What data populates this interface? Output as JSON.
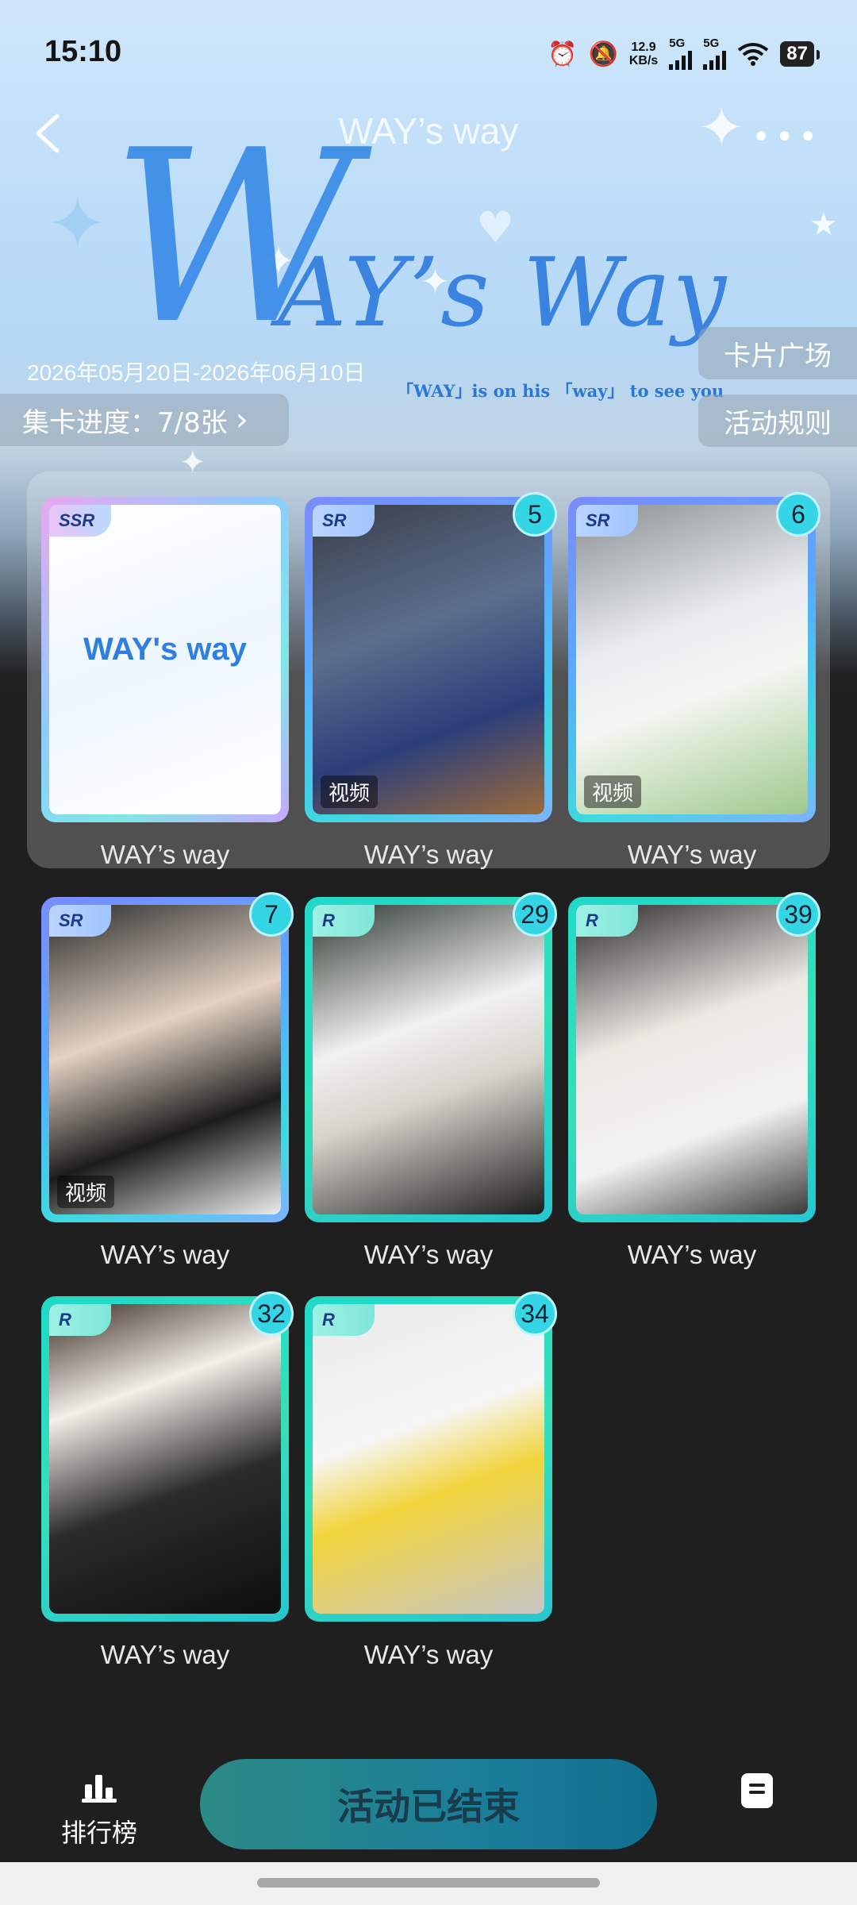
{
  "status_bar": {
    "time": "15:10",
    "net_speed_value": "12.9",
    "net_speed_unit": "KB/s",
    "sim1": "5G",
    "sim2": "5G",
    "battery": "87"
  },
  "nav": {
    "title": "WAY’s way",
    "back_icon": "chevron-left-icon",
    "more_icon": "more-dots-icon"
  },
  "banner": {
    "logo_main": "W",
    "logo_rest": "AY’s Way",
    "logo_tagline": "「WAY」is on his 「way」 to see you",
    "date_range": "2026年05月20日-2026年06月10日",
    "card_square_label": "卡片广场",
    "rules_label": "活动规则",
    "progress_label": "集卡进度：7/8张",
    "progress_arrow": "›"
  },
  "cards": [
    {
      "name": "WAY’s way",
      "rarity": "SSR",
      "count": "",
      "video_tag": "",
      "placeholder_text": "WAY's way"
    },
    {
      "name": "WAY’s way",
      "rarity": "SR",
      "count": "5",
      "video_tag": "视频"
    },
    {
      "name": "WAY’s way",
      "rarity": "SR",
      "count": "6",
      "video_tag": "视频"
    },
    {
      "name": "WAY’s way",
      "rarity": "SR",
      "count": "7",
      "video_tag": "视频"
    },
    {
      "name": "WAY’s way",
      "rarity": "R",
      "count": "29",
      "video_tag": ""
    },
    {
      "name": "WAY’s way",
      "rarity": "R",
      "count": "39",
      "video_tag": ""
    },
    {
      "name": "WAY’s way",
      "rarity": "R",
      "count": "32",
      "video_tag": ""
    },
    {
      "name": "WAY’s way",
      "rarity": "R",
      "count": "34",
      "video_tag": ""
    }
  ],
  "bottom_bar": {
    "rank_label": "排行榜",
    "rank_icon": "bar-chart-icon",
    "main_button": "活动已结束",
    "doc_icon": "document-icon"
  },
  "colors": {
    "accent_blue": "#3d8ee8",
    "frame_r": "#20d9c8",
    "count_badge": "#34d6e6",
    "main_button": "#1b7f9a"
  }
}
